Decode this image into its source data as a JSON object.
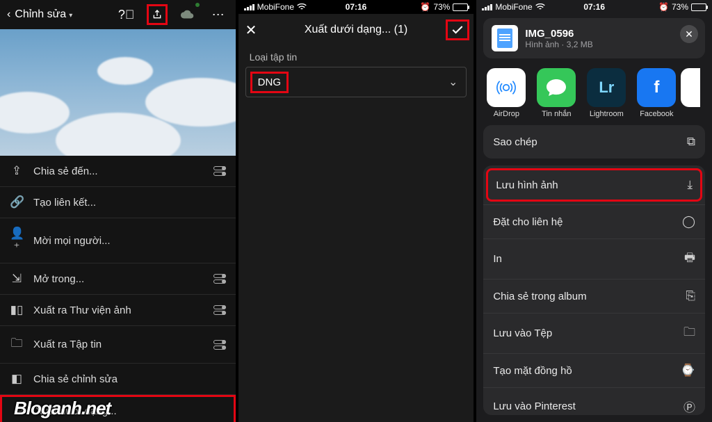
{
  "watermark": "Bloganh.net",
  "p1": {
    "back_label": "Chỉnh sửa",
    "menu": [
      {
        "icon": "share-icon",
        "label": "Chia sẻ đến...",
        "toggle": true
      },
      {
        "icon": "link-icon",
        "label": "Tạo liên kết..."
      },
      {
        "icon": "person-add-icon",
        "label": "Mời mọi người..."
      },
      {
        "icon": "open-in-icon",
        "label": "Mở trong...",
        "toggle": true
      },
      {
        "icon": "gallery-icon",
        "label": "Xuất ra Thư viện ảnh",
        "toggle": true
      },
      {
        "icon": "folder-icon",
        "label": "Xuất ra Tập tin",
        "toggle": true
      },
      {
        "icon": "adjust-share-icon",
        "label": "Chia sẻ chỉnh sửa"
      },
      {
        "icon": "export-as-icon",
        "label": "Xuất dưới dạng..."
      }
    ]
  },
  "p2": {
    "status": {
      "carrier": "MobiFone",
      "time": "07:16",
      "alarm": "⏰",
      "batt": "73%"
    },
    "title": "Xuất dưới dạng... (1)",
    "filetype_label": "Loại tập tin",
    "filetype_value": "DNG"
  },
  "p3": {
    "status": {
      "carrier": "MobiFone",
      "time": "07:16",
      "alarm": "⏰",
      "batt": "73%"
    },
    "file": {
      "name": "IMG_0596",
      "meta": "Hình ảnh · 3,2 MB"
    },
    "apps": [
      {
        "id": "airdrop",
        "label": "AirDrop"
      },
      {
        "id": "messages",
        "label": "Tin nhắn"
      },
      {
        "id": "lightroom",
        "label": "Lightroom",
        "short": "Lr"
      },
      {
        "id": "facebook",
        "label": "Facebook",
        "short": "f"
      }
    ],
    "action_copy": "Sao chép",
    "actions": [
      {
        "id": "save-image",
        "label": "Lưu hình ảnh",
        "icon": "download-icon",
        "hl": true
      },
      {
        "id": "assign-contact",
        "label": "Đặt cho liên hệ",
        "icon": "contact-icon"
      },
      {
        "id": "print",
        "label": "In",
        "icon": "print-icon"
      },
      {
        "id": "share-album",
        "label": "Chia sẻ trong album",
        "icon": "album-icon"
      },
      {
        "id": "save-files",
        "label": "Lưu vào Tệp",
        "icon": "folder-icon"
      },
      {
        "id": "watch-face",
        "label": "Tạo mặt đồng hồ",
        "icon": "watch-icon"
      },
      {
        "id": "pinterest",
        "label": "Lưu vào Pinterest",
        "icon": "pinterest-icon"
      }
    ]
  }
}
